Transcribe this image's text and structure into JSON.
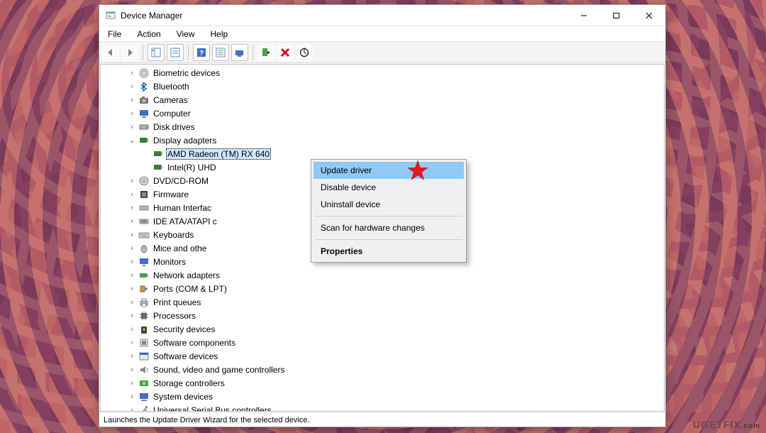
{
  "window": {
    "title": "Device Manager"
  },
  "menu": {
    "file": "File",
    "action": "Action",
    "view": "View",
    "help": "Help"
  },
  "tree": {
    "biometric": "Biometric devices",
    "bluetooth": "Bluetooth",
    "cameras": "Cameras",
    "computer": "Computer",
    "disk": "Disk drives",
    "display": "Display adapters",
    "display_children": {
      "amd": "AMD Radeon (TM) RX 640",
      "intel": "Intel(R) UHD"
    },
    "dvd": "DVD/CD-ROM",
    "firmware": "Firmware",
    "hid": "Human Interfac",
    "ide": "IDE ATA/ATAPI c",
    "keyboards": "Keyboards",
    "mice": "Mice and othe",
    "monitors": "Monitors",
    "netadapt": "Network adapters",
    "ports": "Ports (COM & LPT)",
    "printq": "Print queues",
    "processors": "Processors",
    "security": "Security devices",
    "swcomp": "Software components",
    "swdev": "Software devices",
    "sound": "Sound, video and game controllers",
    "storage": "Storage controllers",
    "sysdev": "System devices",
    "usb": "Universal Serial Bus controllers"
  },
  "context_menu": {
    "update": "Update driver",
    "disable": "Disable device",
    "uninstall": "Uninstall device",
    "scan": "Scan for hardware changes",
    "properties": "Properties"
  },
  "status": "Launches the Update Driver Wizard for the selected device.",
  "watermark": {
    "a": "UGET",
    "b": "FIX",
    "c": ".com"
  }
}
